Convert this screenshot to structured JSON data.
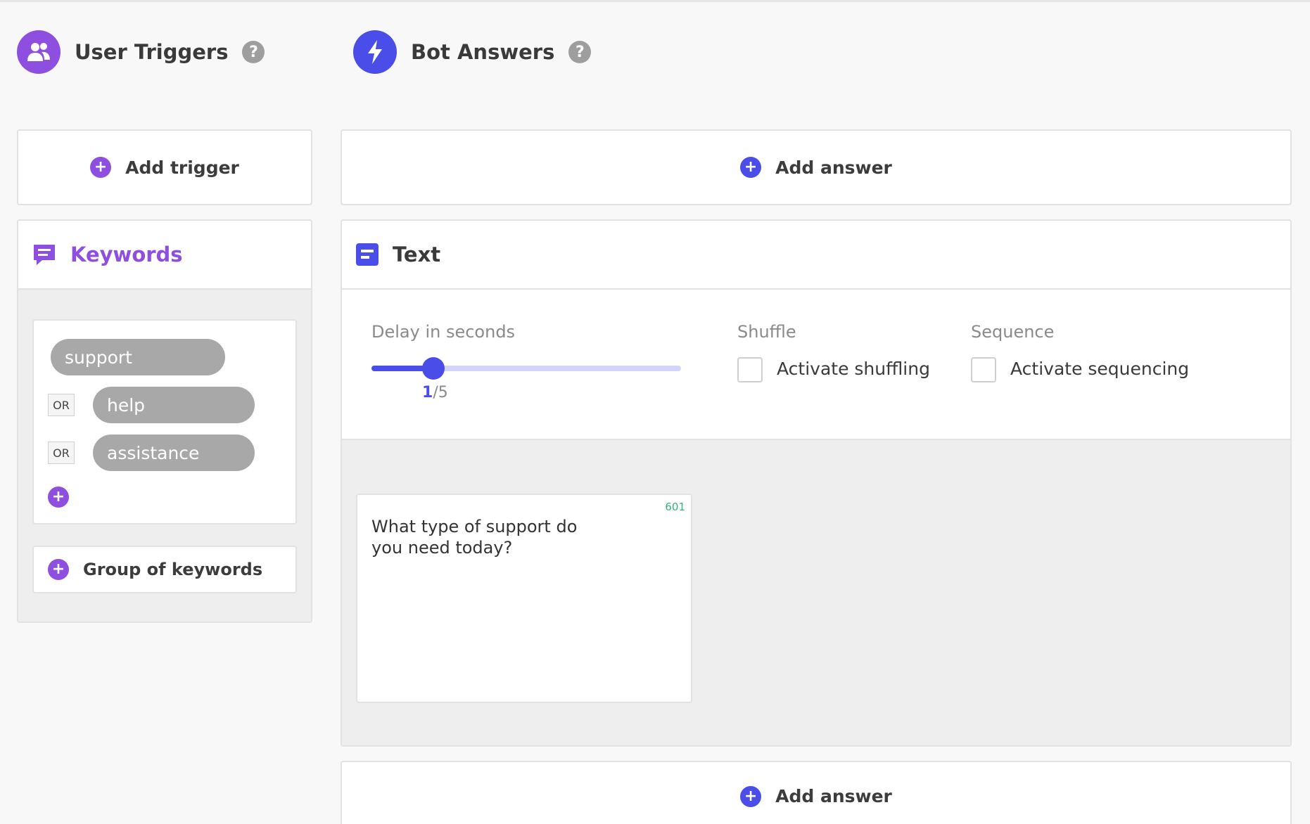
{
  "colors": {
    "purple": "#8e4fe0",
    "blue": "#4b4de8",
    "counter_green": "#34b27b"
  },
  "triggers": {
    "title": "User Triggers",
    "icon": "users-icon",
    "help": "?",
    "add_trigger_label": "Add trigger",
    "keywords_card": {
      "title": "Keywords",
      "icon": "chat-icon",
      "keywords": [
        "support",
        "help",
        "assistance"
      ],
      "or_label": "OR",
      "add_keyword": "+"
    },
    "group_label": "Group of keywords"
  },
  "answers": {
    "title": "Bot Answers",
    "icon": "bolt-icon",
    "help": "?",
    "add_answer_label": "Add answer",
    "text_card": {
      "title": "Text",
      "icon": "text-block-icon",
      "delay_label": "Delay in seconds",
      "delay_value": 1,
      "delay_max": 5,
      "delay_current": "1",
      "delay_max_text": "/5",
      "shuffle_label": "Shuffle",
      "shuffle_option": "Activate shuffling",
      "sequence_label": "Sequence",
      "sequence_option": "Activate sequencing",
      "message": "What type of support do you need today?",
      "char_count": "601"
    },
    "add_answer_bottom_label": "Add answer"
  }
}
